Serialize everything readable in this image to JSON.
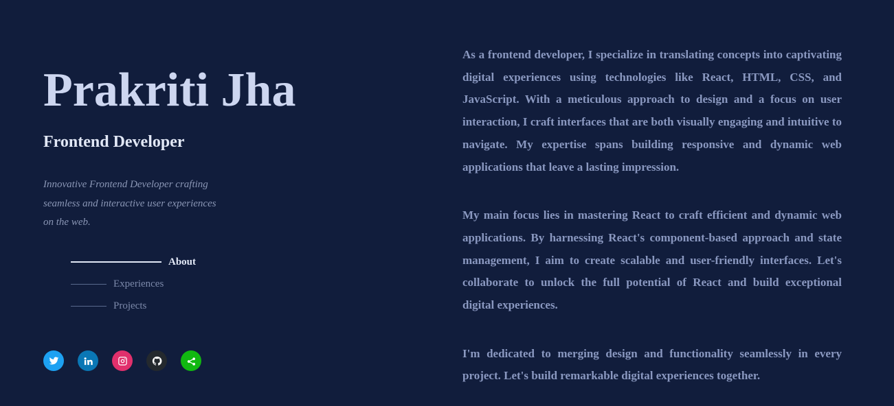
{
  "profile": {
    "name": "Prakriti Jha",
    "role": "Frontend Developer",
    "tagline": "Innovative Frontend Developer crafting seamless and interactive user experiences on the web."
  },
  "nav": {
    "items": [
      {
        "label": "About",
        "active": true
      },
      {
        "label": "Experiences",
        "active": false
      },
      {
        "label": "Projects",
        "active": false
      }
    ]
  },
  "socials": [
    {
      "name": "twitter-icon",
      "color": "#1da1f2"
    },
    {
      "name": "linkedin-icon",
      "color": "#0a77b5"
    },
    {
      "name": "instagram-icon",
      "color": "#e1306c"
    },
    {
      "name": "github-icon",
      "color": "#24292e"
    },
    {
      "name": "share-icon",
      "color": "#11b811"
    }
  ],
  "about": {
    "paragraphs": [
      "As a frontend developer, I specialize in translating concepts into captivating digital experiences using technologies like React, HTML, CSS, and JavaScript. With a meticulous approach to design and a focus on user interaction, I craft interfaces that are both visually engaging and intuitive to navigate. My expertise spans building responsive and dynamic web applications that leave a lasting impression.",
      "My main focus lies in mastering React to craft efficient and dynamic web applications. By harnessing React's component-based approach and state management, I aim to create scalable and user-friendly interfaces. Let's collaborate to unlock the full potential of React and build exceptional digital experiences.",
      "I'm dedicated to merging design and functionality seamlessly in every project. Let's build remarkable digital experiences together."
    ]
  }
}
